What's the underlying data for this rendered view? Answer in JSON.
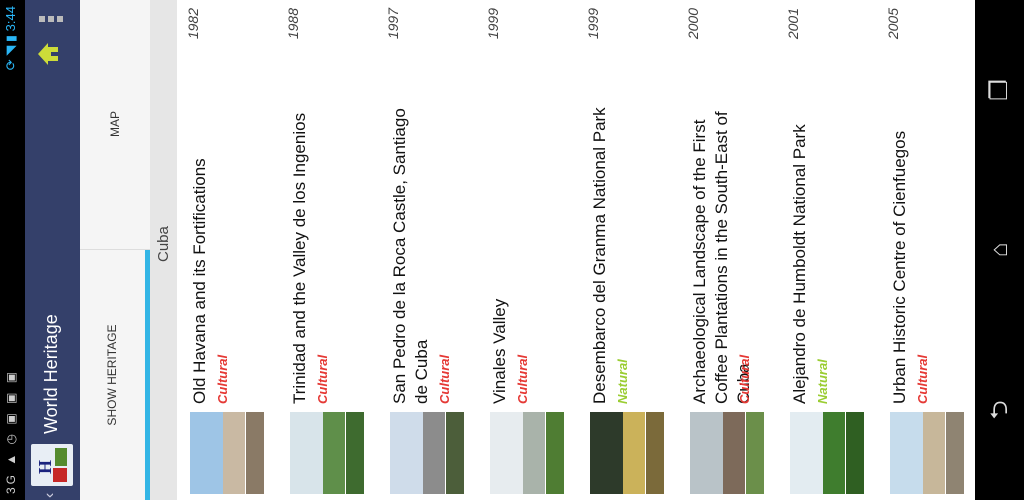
{
  "status_bar": {
    "left_icons": "3G ▲ ◷ ▣ ▣ ▣",
    "right_icons": "⟳ ◥ ▮",
    "time": "3:44"
  },
  "action_bar": {
    "back_icon": "‹",
    "title": "World Heritage",
    "home_icon": "home-icon",
    "menu_icon": "overflow-menu-icon"
  },
  "tabs": [
    {
      "label": "SHOW HERITAGE",
      "selected": true
    },
    {
      "label": "MAP",
      "selected": false
    }
  ],
  "country": "Cuba",
  "colors": {
    "action_bar": "#34406a",
    "tab_indicator": "#33b5e5",
    "cultural": "#e53935",
    "natural": "#9acd32"
  },
  "sites": [
    {
      "name": "Old Havana and its Fortifications",
      "category": "Cultural",
      "year": "1982"
    },
    {
      "name": "Trinidad and the Valley de los Ingenios",
      "category": "Cultural",
      "year": "1988"
    },
    {
      "name": "San Pedro de la Roca Castle, Santiago de Cuba",
      "category": "Cultural",
      "year": "1997"
    },
    {
      "name": "Vinales Valley",
      "category": "Cultural",
      "year": "1999"
    },
    {
      "name": "Desembarco del Granma National Park",
      "category": "Natural",
      "year": "1999"
    },
    {
      "name": "Archaeological Landscape of the First Coffee Plantations in the South-East of Cuba",
      "category": "Cultural",
      "year": "2000"
    },
    {
      "name": "Alejandro de Humboldt National Park",
      "category": "Natural",
      "year": "2001"
    },
    {
      "name": "Urban Historic Centre of Cienfuegos",
      "category": "Cultural",
      "year": "2005"
    }
  ],
  "nav_bar": {
    "back_icon": "⮌",
    "home_icon": "⌂",
    "recent_icon": "❐"
  }
}
